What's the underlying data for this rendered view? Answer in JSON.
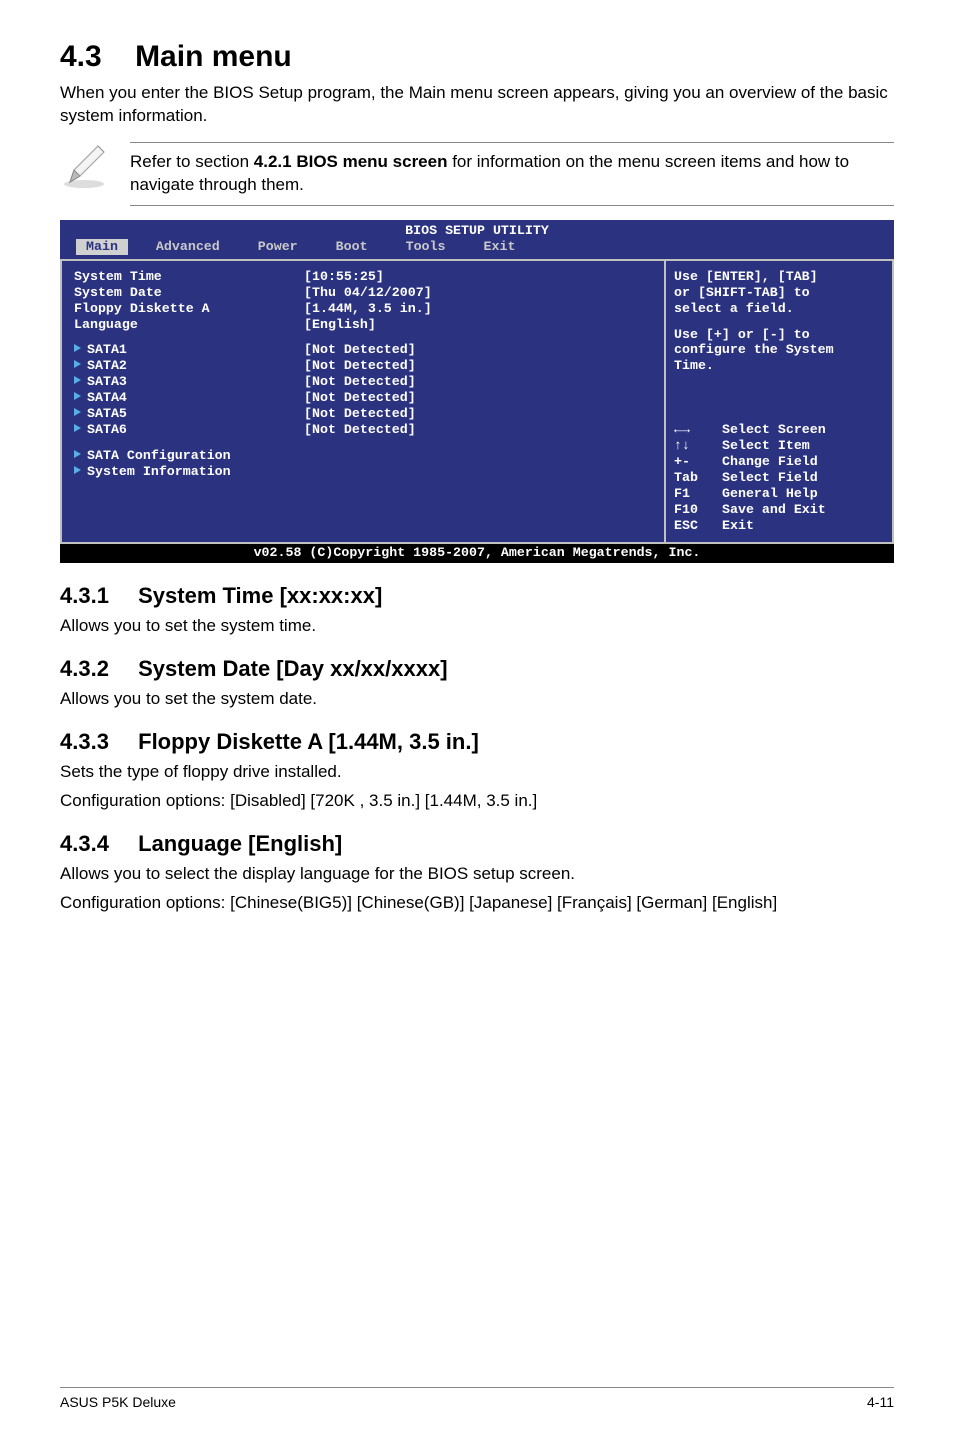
{
  "section": {
    "number": "4.3",
    "title": "Main menu",
    "intro": "When you enter the BIOS Setup program, the Main menu screen appears, giving you an overview of the basic system information."
  },
  "note": {
    "prefix": "Refer to section ",
    "bold": "4.2.1  BIOS menu screen",
    "suffix": " for information on the menu screen items and how to navigate through them."
  },
  "bios": {
    "title": "BIOS SETUP UTILITY",
    "tabs": [
      "Main",
      "Advanced",
      "Power",
      "Boot",
      "Tools",
      "Exit"
    ],
    "selected_tab_index": 0,
    "left_items": [
      {
        "label": "System Time",
        "value": "[10:55:25]"
      },
      {
        "label": "System Date",
        "value": "[Thu 04/12/2007]"
      },
      {
        "label": "Floppy Diskette A",
        "value": "[1.44M, 3.5 in.]"
      },
      {
        "label": "Language",
        "value": "[English]"
      }
    ],
    "sub_items": [
      {
        "label": "SATA1",
        "value": "[Not Detected]"
      },
      {
        "label": "SATA2",
        "value": "[Not Detected]"
      },
      {
        "label": "SATA3",
        "value": "[Not Detected]"
      },
      {
        "label": "SATA4",
        "value": "[Not Detected]"
      },
      {
        "label": "SATA5",
        "value": "[Not Detected]"
      },
      {
        "label": "SATA6",
        "value": "[Not Detected]"
      }
    ],
    "link_items": [
      {
        "label": "SATA Configuration"
      },
      {
        "label": "System Information"
      }
    ],
    "help_top": [
      "Use [ENTER], [TAB]",
      "or [SHIFT-TAB] to",
      "select a field."
    ],
    "help_mid": [
      "Use [+] or [-] to",
      "configure the System",
      "Time."
    ],
    "help_keys": [
      {
        "k": "←→",
        "t": "Select Screen"
      },
      {
        "k": "↑↓",
        "t": "Select Item"
      },
      {
        "k": "+-",
        "t": "Change Field"
      },
      {
        "k": "Tab",
        "t": "Select Field"
      },
      {
        "k": "F1",
        "t": "General Help"
      },
      {
        "k": "F10",
        "t": "Save and Exit"
      },
      {
        "k": "ESC",
        "t": "Exit"
      }
    ],
    "footer": "v02.58 (C)Copyright 1985-2007, American Megatrends, Inc."
  },
  "subs": [
    {
      "num": "4.3.1",
      "title": "System Time [xx:xx:xx]",
      "desc": [
        "Allows you to set the system time."
      ]
    },
    {
      "num": "4.3.2",
      "title": "System Date [Day xx/xx/xxxx]",
      "desc": [
        "Allows you to set the system date."
      ]
    },
    {
      "num": "4.3.3",
      "title": "Floppy Diskette A [1.44M, 3.5 in.]",
      "desc": [
        "Sets the type of floppy drive installed.",
        "Configuration options: [Disabled] [720K , 3.5 in.] [1.44M, 3.5 in.]"
      ]
    },
    {
      "num": "4.3.4",
      "title": "Language [English]",
      "desc": [
        "Allows you to select the display language for the BIOS setup screen.",
        "Configuration options: [Chinese(BIG5)] [Chinese(GB)] [Japanese] [Français] [German] [English]"
      ]
    }
  ],
  "footer": {
    "left": "ASUS P5K Deluxe",
    "right": "4-11"
  }
}
